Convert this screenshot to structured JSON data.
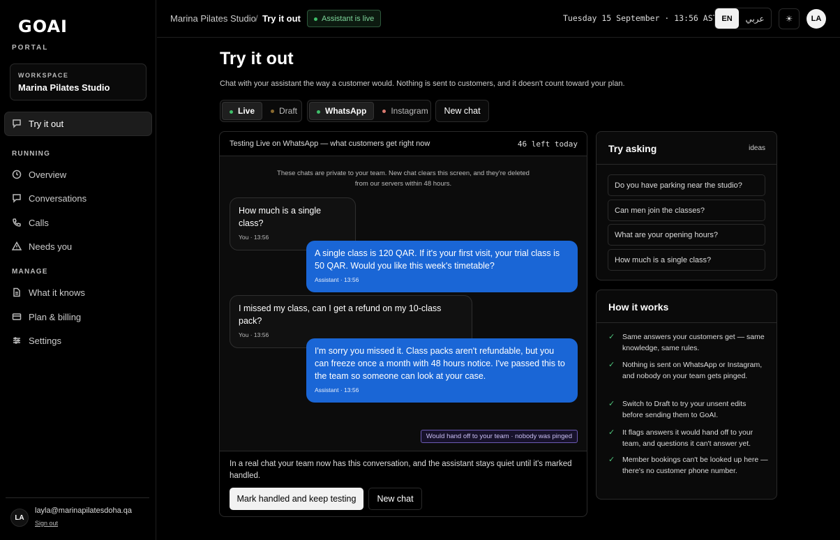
{
  "brand": {
    "logo": "GOAI",
    "portal": "PORTAL"
  },
  "workspace": {
    "label": "WORKSPACE",
    "name": "Marina Pilates Studio"
  },
  "sidebar": {
    "active": {
      "label": "Try it out",
      "icon": "chat-icon"
    },
    "sections": [
      {
        "title": "RUNNING",
        "items": [
          {
            "label": "Overview",
            "icon": "clock-icon"
          },
          {
            "label": "Conversations",
            "icon": "message-icon"
          },
          {
            "label": "Calls",
            "icon": "phone-icon"
          },
          {
            "label": "Needs you",
            "icon": "warning-icon"
          }
        ]
      },
      {
        "title": "MANAGE",
        "items": [
          {
            "label": "What it knows",
            "icon": "document-icon"
          },
          {
            "label": "Plan & billing",
            "icon": "card-icon"
          },
          {
            "label": "Settings",
            "icon": "sliders-icon"
          }
        ]
      }
    ],
    "user": {
      "initials": "LA",
      "email": "layla@marinapilatesdoha.qa",
      "sign_out": "Sign out"
    }
  },
  "header": {
    "crumb_studio": "Marina Pilates Studio",
    "crumb_sep": "/",
    "crumb_page": "Try it out",
    "badge": "Assistant is live",
    "clock": "Tuesday 15 September · 13:56 AST",
    "lang_en": "EN",
    "lang_ar": "عربي",
    "theme_icon": "☀",
    "avatar": "LA"
  },
  "main": {
    "title": "Try it out",
    "description": "Chat with your assistant the way a customer would. Nothing is sent to customers, and it doesn't count toward your plan.",
    "mode": {
      "live": "Live",
      "draft": "Draft",
      "selected": "Live"
    },
    "channel": {
      "whatsapp": "WhatsApp",
      "instagram": "Instagram",
      "selected": "WhatsApp"
    },
    "new_chat": "New chat"
  },
  "chat": {
    "header": "Testing Live on WhatsApp — what customers get right now",
    "remaining": "46 left today",
    "privacy": "These chats are private to your team. New chat clears this screen, and they're deleted from our servers within 48 hours.",
    "messages": [
      {
        "from": "you",
        "text": "How much is a single class?",
        "meta": "You · 13:56"
      },
      {
        "from": "bot",
        "text": "A single class is 120 QAR. If it's your first visit, your trial class is 50 QAR. Would you like this week's timetable?",
        "meta": "Assistant · 13:56"
      },
      {
        "from": "you",
        "text": "I missed my class, can I get a refund on my 10-class pack?",
        "meta": "You · 13:56"
      },
      {
        "from": "bot",
        "text": "I'm sorry you missed it. Class packs aren't refundable, but you can freeze once a month with 48 hours notice. I've passed this to the team so someone can look at your case.",
        "meta": "Assistant · 13:56"
      }
    ],
    "handoff": "Would hand off to your team · nobody was pinged",
    "footer_note": "In a real chat your team now has this conversation, and the assistant stays quiet until it's marked handled.",
    "mark_handled": "Mark handled and keep testing",
    "new_chat": "New chat"
  },
  "try_asking": {
    "title": "Try asking",
    "ideas": "ideas",
    "suggestions": [
      "Do you have parking near the studio?",
      "Can men join the classes?",
      "What are your opening hours?",
      "How much is a single class?"
    ]
  },
  "how_it_works": {
    "title": "How it works",
    "items": [
      "Same answers your customers get — same knowledge, same rules.",
      "Nothing is sent on WhatsApp or Instagram, and nobody on your team gets pinged.",
      "Switch to Draft to try your unsent edits before sending them to GoAI.",
      "It flags answers it would hand off to your team, and questions it can't answer yet.",
      "Member bookings can't be looked up here — there's no customer phone number."
    ]
  },
  "colors": {
    "accent_blue": "#1a66d6",
    "live_green": "#3fbf6a",
    "draft_amber": "#8a6a2f",
    "handoff_purple": "#6c5ab5"
  }
}
